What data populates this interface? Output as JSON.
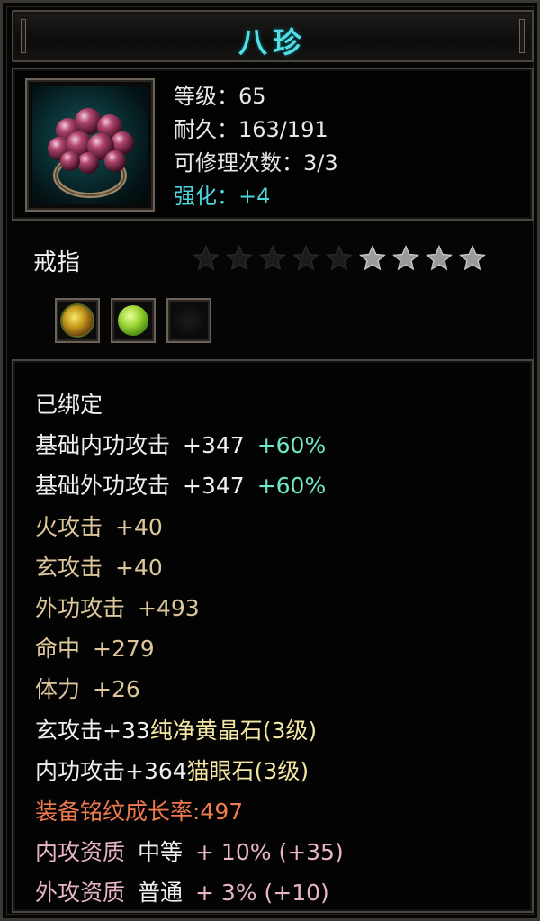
{
  "title": "八珍",
  "colors": {
    "title": "#52e0e8",
    "enhance": "#4fd3dc",
    "white": "#f0f0f0",
    "tan": "#ddc79a",
    "yellow": "#f4e7a4",
    "orange": "#f07a4e",
    "pink": "#e8b5c6",
    "bonus": "#6ee8c8"
  },
  "header": {
    "level_label": "等级：",
    "level_value": "65",
    "durability_label": "耐久：",
    "durability_value": "163/191",
    "repair_label": "可修理次数：",
    "repair_value": "3/3",
    "enhance_label": "强化：",
    "enhance_value": "+4"
  },
  "item_type": "戒指",
  "stars": {
    "total": 9,
    "filled": 4
  },
  "gem_slots": [
    {
      "icon": "yellow-crystal-gem-icon",
      "color": "#c8b020"
    },
    {
      "icon": "cats-eye-gem-icon",
      "color": "#9ad232"
    },
    {
      "icon": "empty-gem-slot",
      "color": ""
    }
  ],
  "attributes": {
    "bound": "已绑定",
    "base_inner_atk": {
      "label": "基础内功攻击",
      "value": "+347",
      "bonus": "+60%"
    },
    "base_outer_atk": {
      "label": "基础外功攻击",
      "value": "+347",
      "bonus": "+60%"
    },
    "fire_atk": {
      "label": "火攻击",
      "value": "+40"
    },
    "mystic_atk": {
      "label": "玄攻击",
      "value": "+40"
    },
    "outer_atk": {
      "label": "外功攻击",
      "value": "+493"
    },
    "accuracy": {
      "label": "命中",
      "value": "+279"
    },
    "stamina": {
      "label": "体力",
      "value": "+26"
    },
    "gem1": {
      "stat": "玄攻击+33",
      "gem": "纯净黄晶石(3级)"
    },
    "gem2": {
      "stat": "内功攻击+364",
      "gem": "猫眼石(3级)"
    },
    "growth": "装备铭纹成长率:497",
    "inner_quality": {
      "label": "内攻资质",
      "grade": "中等",
      "value": "+ 10% (+35)"
    },
    "outer_quality": {
      "label": "外攻资质",
      "grade": "普通",
      "value": "+ 3% (+10)"
    }
  }
}
